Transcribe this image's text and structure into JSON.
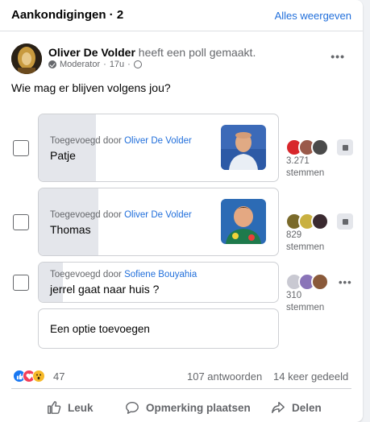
{
  "header": {
    "title": "Aankondigingen · 2",
    "see_all": "Alles weergeven"
  },
  "post": {
    "author": "Oliver De Volder",
    "action": "heeft een poll gemaakt.",
    "role": "Moderator",
    "time": "17u",
    "question": "Wie mag er blijven volgens jou?"
  },
  "poll": {
    "added_by_prefix": "Toegevoegd door",
    "votes_unit": "stemmen",
    "options": [
      {
        "name": "Patje",
        "added_by": "Oliver De Volder",
        "votes": "3.271",
        "share": 0.24
      },
      {
        "name": "Thomas",
        "added_by": "Oliver De Volder",
        "votes": "829",
        "share": 0.25
      },
      {
        "name": "jerrel gaat naar huis ?",
        "added_by": "Sofiene Bouyahia",
        "votes": "310",
        "share": 0.1
      }
    ],
    "add_option": "Een optie toevoegen"
  },
  "footer": {
    "reactions_count": "47",
    "answers": "107 antwoorden",
    "shares": "14 keer gedeeld",
    "like": "Leuk",
    "comment": "Opmerking plaatsen",
    "share": "Delen"
  },
  "colors": {
    "link": "#216fdb",
    "muted": "#65676b",
    "fill": "#e4e6eb",
    "like": "#1877f2",
    "love": "#f33e58",
    "wow": "#f7b928"
  }
}
